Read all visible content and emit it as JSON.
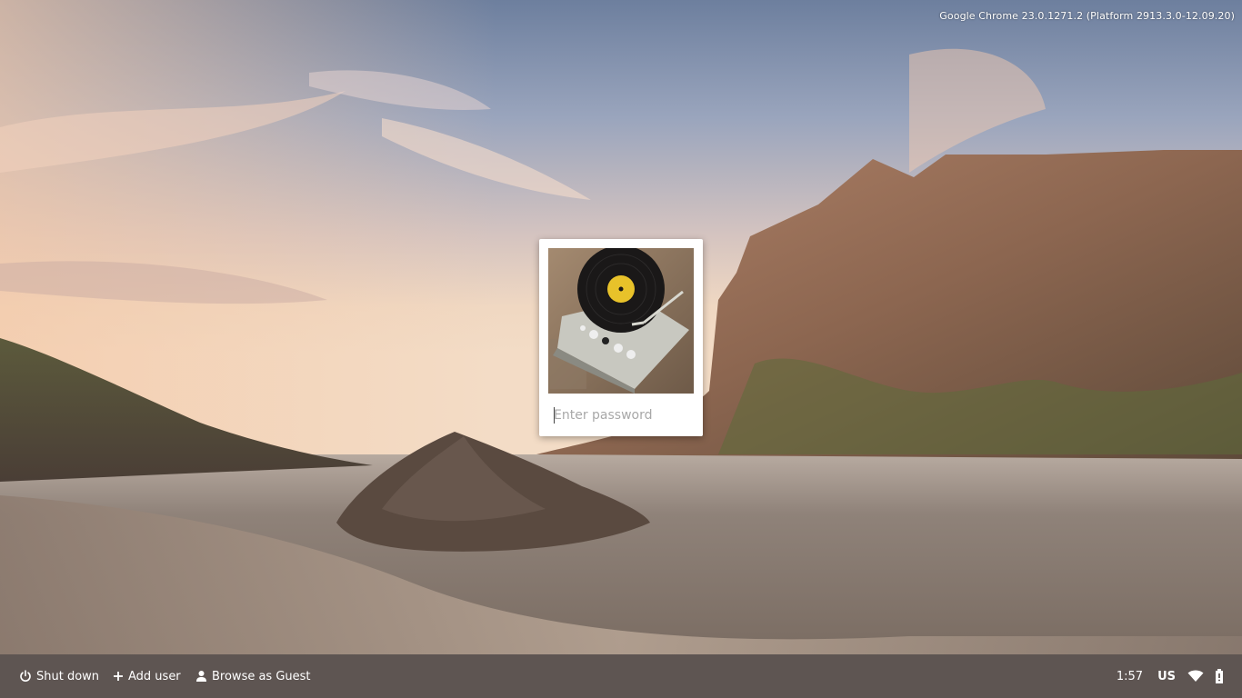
{
  "version_info": "Google Chrome 23.0.1271.2 (Platform 2913.3.0-12.09.20)",
  "user_pod": {
    "avatar": "vinyl-record-player-image",
    "password_placeholder": "Enter password",
    "password_value": ""
  },
  "shelf": {
    "shutdown_label": "Shut down",
    "add_user_label": "Add user",
    "guest_label": "Browse as Guest"
  },
  "tray": {
    "time": "1:57",
    "ime": "US",
    "wifi_icon": "wifi-icon",
    "battery_icon": "battery-icon"
  },
  "colors": {
    "shelf_bg": "#3a302c",
    "pod_bg": "#ffffff",
    "placeholder": "#a8a8a8",
    "text_light": "#ffffff"
  }
}
